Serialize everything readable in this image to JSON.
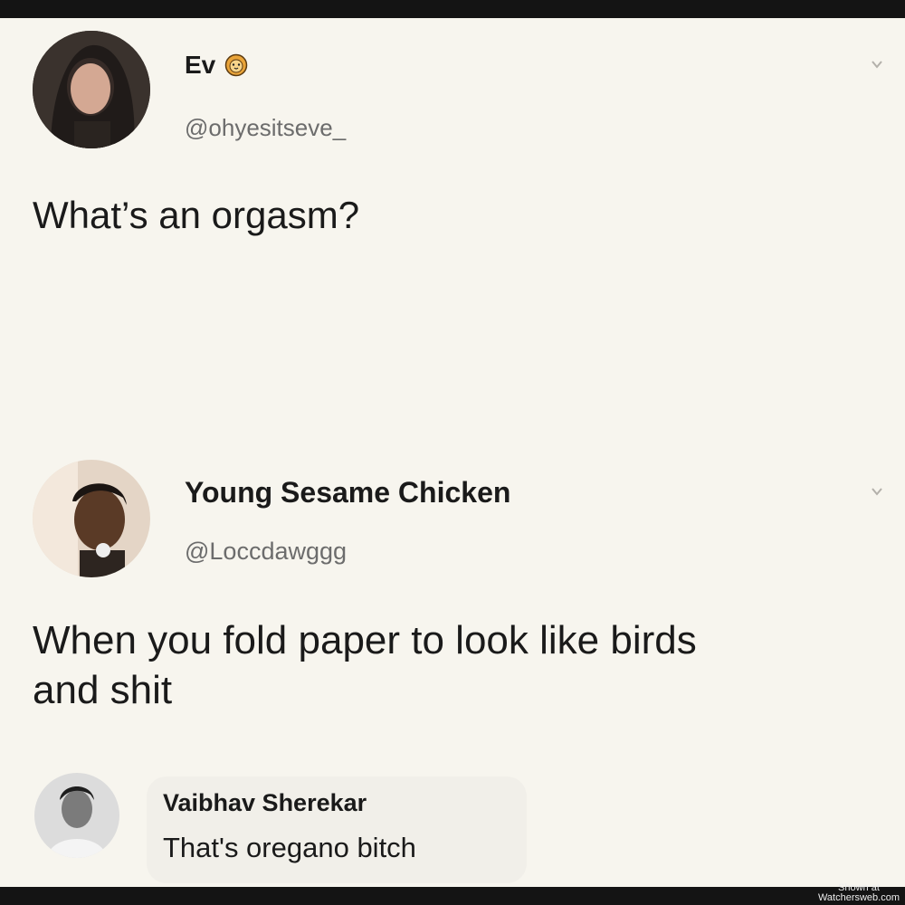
{
  "tweet": {
    "author_name": "Ev",
    "author_handle": "@ohyesitseve_",
    "text": "What’s an orgasm?",
    "badge_icon": "lion-face-icon",
    "menu_icon": "chevron-down-icon"
  },
  "reply_tweet": {
    "author_name": "Young Sesame Chicken",
    "author_handle": "@Loccdawggg",
    "text_line1": "When you fold paper to look like birds",
    "text_line2": "and shit",
    "menu_icon": "chevron-down-icon"
  },
  "comment": {
    "author_name": "Vaibhav Sherekar",
    "text": "That's oregano bitch"
  },
  "watermark": {
    "line1": "Shown at",
    "line2": "Watchersweb.com"
  },
  "colors": {
    "background": "#f7f5ee",
    "text": "#1a1a1a",
    "handle": "#6c6c6c",
    "frame": "#141414"
  }
}
